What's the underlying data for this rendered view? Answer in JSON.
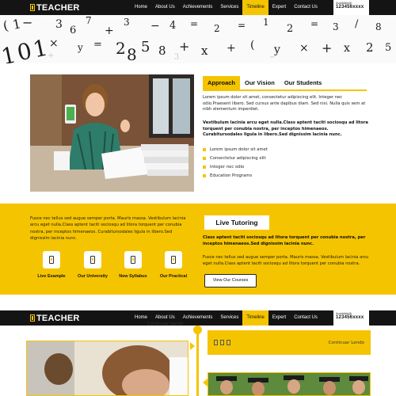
{
  "brand": {
    "name": "TEACHER",
    "brand_color": "#f5c400"
  },
  "nav": {
    "items": [
      {
        "label": "Home"
      },
      {
        "label": "About Us"
      },
      {
        "label": "Achievements"
      },
      {
        "label": "Services"
      },
      {
        "label": "Timeline",
        "active": true
      },
      {
        "label": "Expert"
      },
      {
        "label": "Contact Us"
      }
    ],
    "available_label": "Available@",
    "phone": "123456xxxx"
  },
  "approach": {
    "tabs": [
      {
        "label": "Approach",
        "active": true
      },
      {
        "label": "Our Vision"
      },
      {
        "label": "Our Students"
      }
    ],
    "paragraph": "Lorem ipsum dolor sit amet, consectetur adipiscing elit. Integer nec odio.Praesent libero. Sed cursus ante dapibus diam. Sed nisi. Nulla quis sem at nibh elementum imperdiet.",
    "bold_paragraph": "Vestibulum lacinia arcu eget nulla.Class aptent taciti sociosqu ad litora torquent per conubia nostra, per inceptos himenaeos. Curabitursodales ligula in libero.Sed dignissim lacinia nunc.",
    "bullets": [
      "Lorem ipsum dolor sit amet",
      "Consectetur adipiscing elit",
      "Integer nec odio",
      "Education Programs"
    ]
  },
  "tutoring": {
    "left_paragraph": "Fusce nec tellus sed augue semper porta. Mauris massa. Vestibulum lacinia arcu eget nulla.Class aptent taciti sociosqu ad litora torquent per conubia nostra, per inceptos himenaeos. Curabitursodales ligula in libero.Sed dignissim lacinia nunc.",
    "features": [
      {
        "label": "Live Example",
        "icon": "mobile-icon"
      },
      {
        "label": "Our University",
        "icon": "mobile-icon"
      },
      {
        "label": "New Syllabus",
        "icon": "mobile-icon"
      },
      {
        "label": "Our Practical",
        "icon": "mobile-icon"
      }
    ],
    "title": "Live Tutoring",
    "bold_paragraph": "Class aptent taciti sociosqu ad litora torquent per conubia nostra, per inceptos himenaeos.Sed dignissim lacinia nunc.",
    "paragraph": "Fusce nec tellus sed augue semper porta. Mauris massa. Vestibulum lacinia arcu eget nulla.Class aptent taciti sociosqu ad litora torquent per conubia nostra.",
    "button_label": "View Our Courses"
  },
  "timeline": {
    "continue_left": "Continuar Lendo",
    "continue_right": "Continuar Lendo"
  },
  "hero": {
    "glyphs": [
      "1",
      "0",
      "1",
      "(",
      "1",
      "−",
      "×",
      "3",
      "6",
      "7",
      "y",
      "=",
      "+",
      "2",
      "8",
      "5",
      "3",
      "−",
      "8",
      "4",
      "+",
      "=",
      "x",
      "2",
      "+",
      "=",
      "(",
      "1",
      "y",
      "2",
      "×",
      "=",
      "+",
      "3",
      "x",
      "/",
      "2",
      "8",
      "5",
      "+",
      "3",
      "−"
    ]
  }
}
